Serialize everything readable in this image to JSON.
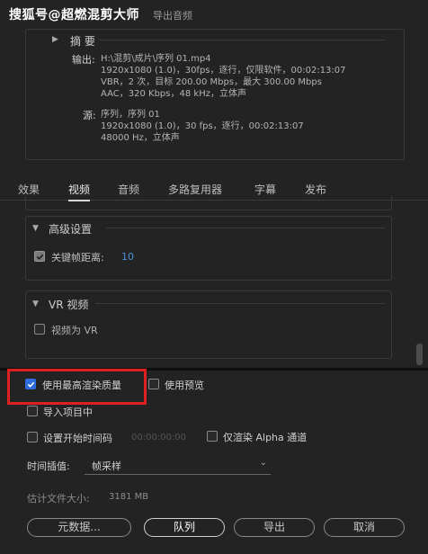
{
  "watermark": "搜狐号@超燃混剪大师",
  "header": {
    "export_audio": "导出音频"
  },
  "summary": {
    "title": "摘 要",
    "output_label": "输出:",
    "output_lines": [
      "H:\\混剪\\成片\\序列 01.mp4",
      "1920x1080 (1.0)，30fps，逐行，仅限软件，00:02:13:07",
      "VBR，2 次，目标 200.00 Mbps，最大 300.00 Mbps",
      "AAC，320 Kbps，48 kHz，立体声"
    ],
    "source_label": "源:",
    "source_lines": [
      "序列，序列 01",
      "1920x1080 (1.0)，30 fps，逐行，00:02:13:07",
      "48000 Hz，立体声"
    ]
  },
  "tabs": [
    {
      "label": "效果",
      "active": false
    },
    {
      "label": "视频",
      "active": true
    },
    {
      "label": "音频",
      "active": false
    },
    {
      "label": "多路复用器",
      "active": false
    },
    {
      "label": "字幕",
      "active": false
    },
    {
      "label": "发布",
      "active": false
    }
  ],
  "advanced": {
    "title": "高级设置",
    "keyframe_label": "关键帧距离:",
    "keyframe_value": "10",
    "keyframe_checked": true
  },
  "vr": {
    "title": "VR 视频",
    "vr_label": "视频为 VR",
    "vr_checked": false
  },
  "options": {
    "max_render_quality": "使用最高渲染质量",
    "max_render_quality_checked": true,
    "use_preview": "使用预览",
    "use_preview_checked": false,
    "import_project": "导入项目中",
    "import_project_checked": false,
    "set_timecode": "设置开始时间码",
    "set_timecode_checked": false,
    "timecode_value": "00:00:00:00",
    "alpha_only": "仅渲染 Alpha 通道",
    "alpha_only_checked": false
  },
  "interpolation": {
    "label": "时间插值:",
    "value": "帧采样"
  },
  "filesize": {
    "label": "估计文件大小:",
    "value": "3181 MB"
  },
  "buttons": {
    "metadata": "元数据...",
    "queue": "队列",
    "export": "导出",
    "cancel": "取消"
  },
  "colors": {
    "background": "#232323",
    "accent_blue": "#2d6cdf",
    "highlight_red": "#e02020",
    "value_blue": "#4a8fe0"
  }
}
